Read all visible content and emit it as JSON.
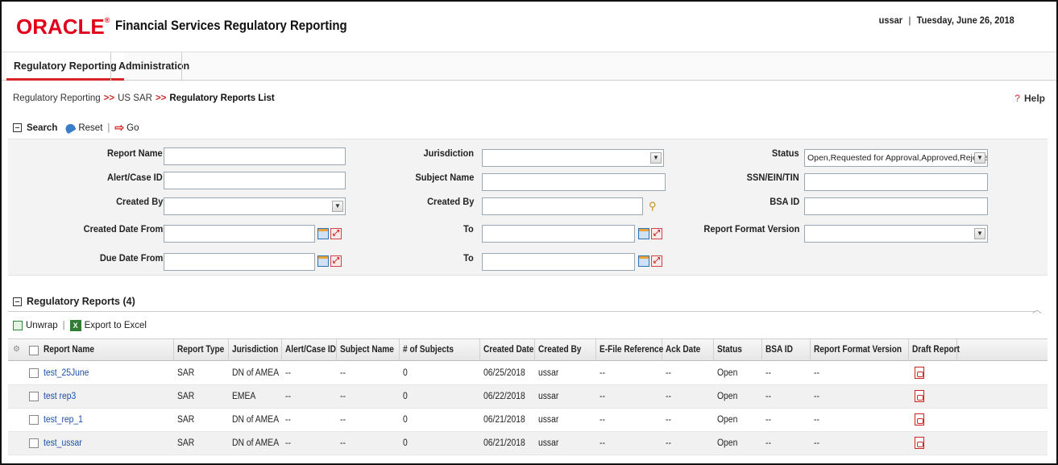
{
  "header": {
    "logo": "ORACLE",
    "app_title": "Financial Services Regulatory Reporting",
    "user": "ussar",
    "date": "Tuesday, June 26, 2018"
  },
  "tabs": [
    {
      "label": "Regulatory Reporting",
      "active": true
    },
    {
      "label": "Administration",
      "active": false
    }
  ],
  "breadcrumb": {
    "items": [
      "Regulatory Reporting",
      "US SAR",
      "Regulatory Reports List"
    ],
    "separator": ">>"
  },
  "help_label": "Help",
  "search_toolbar": {
    "search": "Search",
    "reset": "Reset",
    "go": "Go"
  },
  "search_form": {
    "report_name": {
      "label": "Report Name",
      "value": ""
    },
    "alert_case_id": {
      "label": "Alert/Case ID",
      "value": ""
    },
    "created_by_1": {
      "label": "Created By",
      "value": ""
    },
    "created_date_from": {
      "label": "Created Date From",
      "value": ""
    },
    "due_date_from": {
      "label": "Due Date From",
      "value": ""
    },
    "jurisdiction": {
      "label": "Jurisdiction",
      "value": ""
    },
    "subject_name": {
      "label": "Subject Name",
      "value": ""
    },
    "created_by_2": {
      "label": "Created By",
      "value": ""
    },
    "to_1": {
      "label": "To",
      "value": ""
    },
    "to_2": {
      "label": "To",
      "value": ""
    },
    "status": {
      "label": "Status",
      "value": "Open,Requested for Approval,Approved,Rejecte"
    },
    "ssn": {
      "label": "SSN/EIN/TIN",
      "value": ""
    },
    "bsa_id": {
      "label": "BSA ID",
      "value": ""
    },
    "report_format_version": {
      "label": "Report Format Version",
      "value": ""
    }
  },
  "reports": {
    "title": "Regulatory Reports (4)",
    "unwrap": "Unwrap",
    "export": "Export to Excel",
    "columns": [
      "Report Name",
      "Report Type",
      "Jurisdiction",
      "Alert/Case ID",
      "Subject Name",
      "# of Subjects",
      "Created Date",
      "Created By",
      "E-File Reference",
      "Ack Date",
      "Status",
      "BSA ID",
      "Report Format Version",
      "Draft Report"
    ],
    "rows": [
      {
        "name": "test_25June",
        "type": "SAR",
        "jurisdiction": "DN of AMEA",
        "alert": "--",
        "subject": "--",
        "num": "0",
        "created_date": "06/25/2018",
        "created_by": "ussar",
        "efile": "--",
        "ack": "--",
        "status": "Open",
        "bsa": "--",
        "rfv": "--"
      },
      {
        "name": "test rep3",
        "type": "SAR",
        "jurisdiction": "EMEA",
        "alert": "--",
        "subject": "--",
        "num": "0",
        "created_date": "06/22/2018",
        "created_by": "ussar",
        "efile": "--",
        "ack": "--",
        "status": "Open",
        "bsa": "--",
        "rfv": "--"
      },
      {
        "name": "test_rep_1",
        "type": "SAR",
        "jurisdiction": "DN of AMEA",
        "alert": "--",
        "subject": "--",
        "num": "0",
        "created_date": "06/21/2018",
        "created_by": "ussar",
        "efile": "--",
        "ack": "--",
        "status": "Open",
        "bsa": "--",
        "rfv": "--"
      },
      {
        "name": "test_ussar",
        "type": "SAR",
        "jurisdiction": "DN of AMEA",
        "alert": "--",
        "subject": "--",
        "num": "0",
        "created_date": "06/21/2018",
        "created_by": "ussar",
        "efile": "--",
        "ack": "--",
        "status": "Open",
        "bsa": "--",
        "rfv": "--"
      }
    ]
  }
}
